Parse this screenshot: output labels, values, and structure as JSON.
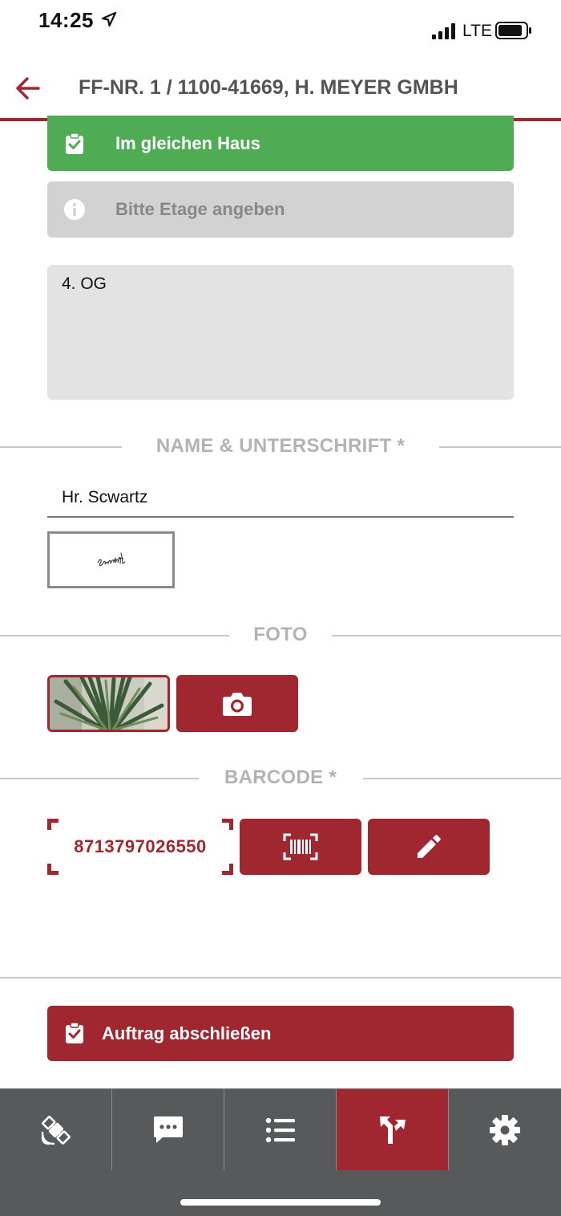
{
  "status_bar": {
    "time": "14:25",
    "network": "LTE"
  },
  "header": {
    "title": "FF-NR. 1 / 1100-41669, H. MEYER GMBH"
  },
  "notices": {
    "same_house": "Im gleichen Haus",
    "floor_hint": "Bitte Etage angeben"
  },
  "floor_input": {
    "value": "4. OG"
  },
  "sections": {
    "name_signature": "NAME & UNTERSCHRIFT *",
    "photo": "FOTO",
    "barcode": "BARCODE *"
  },
  "name_input": {
    "value": "Hr. Scwartz"
  },
  "barcode": {
    "value": "8713797026550"
  },
  "finish_button": {
    "label": "Auftrag abschließen"
  },
  "tabs": [
    {
      "icon": "satellite-icon",
      "active": false
    },
    {
      "icon": "chat-icon",
      "active": false
    },
    {
      "icon": "list-icon",
      "active": false
    },
    {
      "icon": "route-icon",
      "active": true
    },
    {
      "icon": "gear-icon",
      "active": false
    }
  ],
  "colors": {
    "brand_red": "#a0262f",
    "success_green": "#4fac54",
    "notice_grey": "#d2d2d2",
    "tab_bar": "#58595b"
  }
}
